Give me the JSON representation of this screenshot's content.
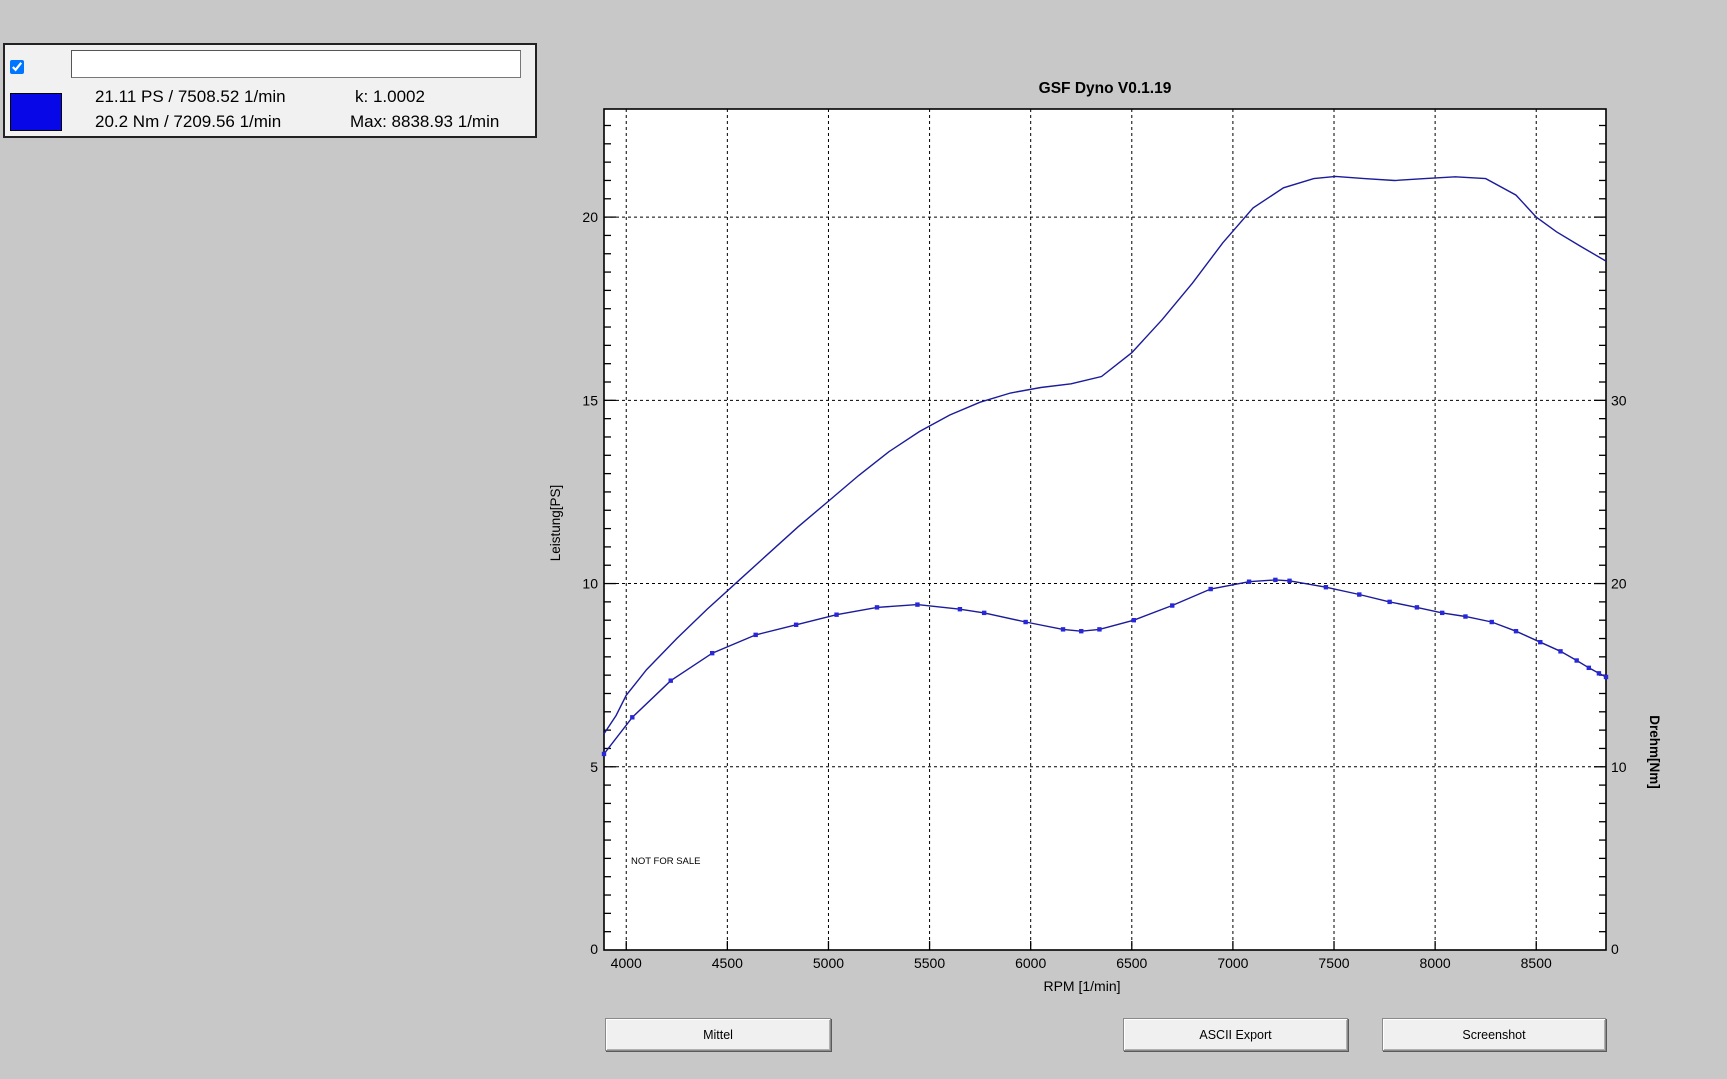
{
  "window": {
    "background": "#c8c8c8"
  },
  "info_panel": {
    "checkbox_checked": true,
    "input_value": "",
    "swatch_color": "#0707e8",
    "line1_left": "21.11 PS / 7508.52 1/min",
    "line1_right": "k: 1.0002",
    "line2_left": "20.2 Nm / 7209.56 1/min",
    "line2_right": "Max: 8838.93 1/min"
  },
  "buttons": {
    "mittel": "Mittel",
    "ascii_export": "ASCII Export",
    "screenshot": "Screenshot"
  },
  "chart_data": {
    "type": "line",
    "title": "GSF Dyno V0.1.19",
    "xlabel": "RPM [1/min]",
    "ylabel_left": "Leistung[PS]",
    "ylabel_right": "Drehm[Nm]",
    "watermark": "NOT FOR SALE",
    "grid": true,
    "xlim": [
      3890,
      8845
    ],
    "ylim_left": [
      0,
      22.95
    ],
    "ylim_right": [
      0,
      45.9
    ],
    "x_ticks": [
      4000,
      4500,
      5000,
      5500,
      6000,
      6500,
      7000,
      7500,
      8000,
      8500
    ],
    "y_ticks_left": [
      0,
      5,
      10,
      15,
      20
    ],
    "y_ticks_right": [
      0,
      10,
      20,
      30
    ],
    "line_color": "#1b1b9b",
    "marker_color": "#2828d8",
    "series": [
      {
        "name": "leistung",
        "axis": "left",
        "unit": "PS",
        "markers": false,
        "points": [
          [
            3890,
            5.9
          ],
          [
            3950,
            6.4
          ],
          [
            4000,
            6.95
          ],
          [
            4100,
            7.65
          ],
          [
            4250,
            8.5
          ],
          [
            4400,
            9.3
          ],
          [
            4550,
            10.05
          ],
          [
            4700,
            10.8
          ],
          [
            4850,
            11.55
          ],
          [
            5000,
            12.25
          ],
          [
            5150,
            12.95
          ],
          [
            5300,
            13.6
          ],
          [
            5450,
            14.15
          ],
          [
            5600,
            14.6
          ],
          [
            5750,
            14.95
          ],
          [
            5900,
            15.2
          ],
          [
            6050,
            15.35
          ],
          [
            6200,
            15.45
          ],
          [
            6350,
            15.65
          ],
          [
            6500,
            16.3
          ],
          [
            6650,
            17.2
          ],
          [
            6800,
            18.2
          ],
          [
            6950,
            19.3
          ],
          [
            7100,
            20.25
          ],
          [
            7250,
            20.8
          ],
          [
            7400,
            21.05
          ],
          [
            7508,
            21.11
          ],
          [
            7650,
            21.05
          ],
          [
            7800,
            21.0
          ],
          [
            7950,
            21.05
          ],
          [
            8100,
            21.1
          ],
          [
            8250,
            21.05
          ],
          [
            8400,
            20.6
          ],
          [
            8500,
            20.0
          ],
          [
            8600,
            19.6
          ],
          [
            8720,
            19.2
          ],
          [
            8845,
            18.8
          ]
        ]
      },
      {
        "name": "drehmoment",
        "axis": "right",
        "unit": "Nm",
        "markers": true,
        "points": [
          [
            3890,
            10.7
          ],
          [
            4030,
            12.7
          ],
          [
            4220,
            14.7
          ],
          [
            4425,
            16.2
          ],
          [
            4640,
            17.2
          ],
          [
            4840,
            17.75
          ],
          [
            5040,
            18.3
          ],
          [
            5240,
            18.7
          ],
          [
            5440,
            18.85
          ],
          [
            5650,
            18.6
          ],
          [
            5770,
            18.4
          ],
          [
            5975,
            17.9
          ],
          [
            6160,
            17.5
          ],
          [
            6250,
            17.4
          ],
          [
            6340,
            17.5
          ],
          [
            6510,
            18.0
          ],
          [
            6700,
            18.8
          ],
          [
            6890,
            19.7
          ],
          [
            7080,
            20.1
          ],
          [
            7210,
            20.2
          ],
          [
            7280,
            20.15
          ],
          [
            7460,
            19.8
          ],
          [
            7625,
            19.4
          ],
          [
            7775,
            19.0
          ],
          [
            7910,
            18.7
          ],
          [
            8035,
            18.4
          ],
          [
            8150,
            18.2
          ],
          [
            8280,
            17.9
          ],
          [
            8400,
            17.4
          ],
          [
            8520,
            16.8
          ],
          [
            8620,
            16.3
          ],
          [
            8700,
            15.8
          ],
          [
            8760,
            15.4
          ],
          [
            8810,
            15.1
          ],
          [
            8845,
            14.9
          ]
        ]
      }
    ]
  }
}
